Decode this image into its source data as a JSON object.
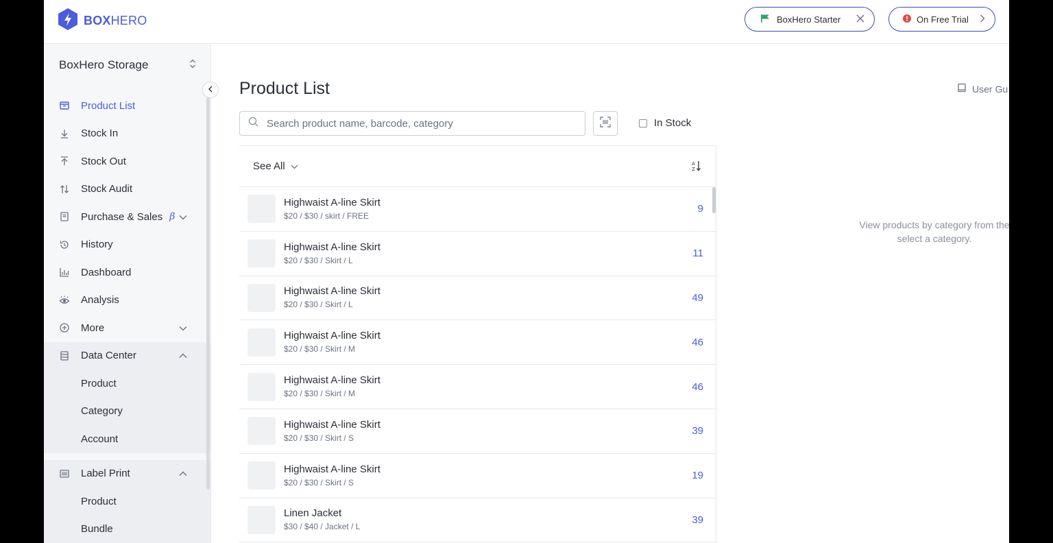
{
  "header": {
    "logo_box": "BOX",
    "logo_hero": "HERO",
    "plan_pill": "BoxHero Starter",
    "trial_pill": "On Free Trial"
  },
  "sidebar": {
    "storage_name": "BoxHero Storage",
    "items": [
      {
        "label": "Product List",
        "icon": "box-icon",
        "active": true
      },
      {
        "label": "Stock In",
        "icon": "arrow-down-icon"
      },
      {
        "label": "Stock Out",
        "icon": "arrow-up-icon"
      },
      {
        "label": "Stock Audit",
        "icon": "swap-icon"
      },
      {
        "label": "Purchase & Sales",
        "icon": "document-icon",
        "badge": "β"
      },
      {
        "label": "History",
        "icon": "history-icon"
      },
      {
        "label": "Dashboard",
        "icon": "bar-chart-icon"
      },
      {
        "label": "Analysis",
        "icon": "eye-icon"
      },
      {
        "label": "More",
        "icon": "plus-circle-icon"
      }
    ],
    "data_center": {
      "label": "Data Center",
      "sub": [
        "Product",
        "Category",
        "Account"
      ]
    },
    "label_print": {
      "label": "Label Print",
      "sub": [
        "Product",
        "Bundle"
      ]
    }
  },
  "main": {
    "title": "Product List",
    "user_guide": "User Gu",
    "search_placeholder": "Search product name, barcode, category",
    "in_stock_label": "In Stock",
    "filter_label": "See All",
    "products": [
      {
        "name": "Highwaist A-line Skirt",
        "meta": "$20 / $30 / skirt / FREE",
        "qty": "9"
      },
      {
        "name": "Highwaist A-line Skirt",
        "meta": "$20 / $30 / Skirt / L",
        "qty": "11"
      },
      {
        "name": "Highwaist A-line Skirt",
        "meta": "$20 / $30 / Skirt / L",
        "qty": "49"
      },
      {
        "name": "Highwaist A-line Skirt",
        "meta": "$20 / $30 / Skirt / M",
        "qty": "46"
      },
      {
        "name": "Highwaist A-line Skirt",
        "meta": "$20 / $30 / Skirt / M",
        "qty": "46"
      },
      {
        "name": "Highwaist A-line Skirt",
        "meta": "$20 / $30 / Skirt / S",
        "qty": "39"
      },
      {
        "name": "Highwaist A-line Skirt",
        "meta": "$20 / $30 / Skirt / S",
        "qty": "19"
      },
      {
        "name": "Linen Jacket",
        "meta": "$30 / $40 / Jacket / L",
        "qty": "39"
      }
    ],
    "empty_line1": "View products by category from the",
    "empty_line2": "select a category."
  },
  "colors": {
    "accent": "#4a5ddb",
    "alert": "#e5484d",
    "flag": "#2fa36b"
  }
}
